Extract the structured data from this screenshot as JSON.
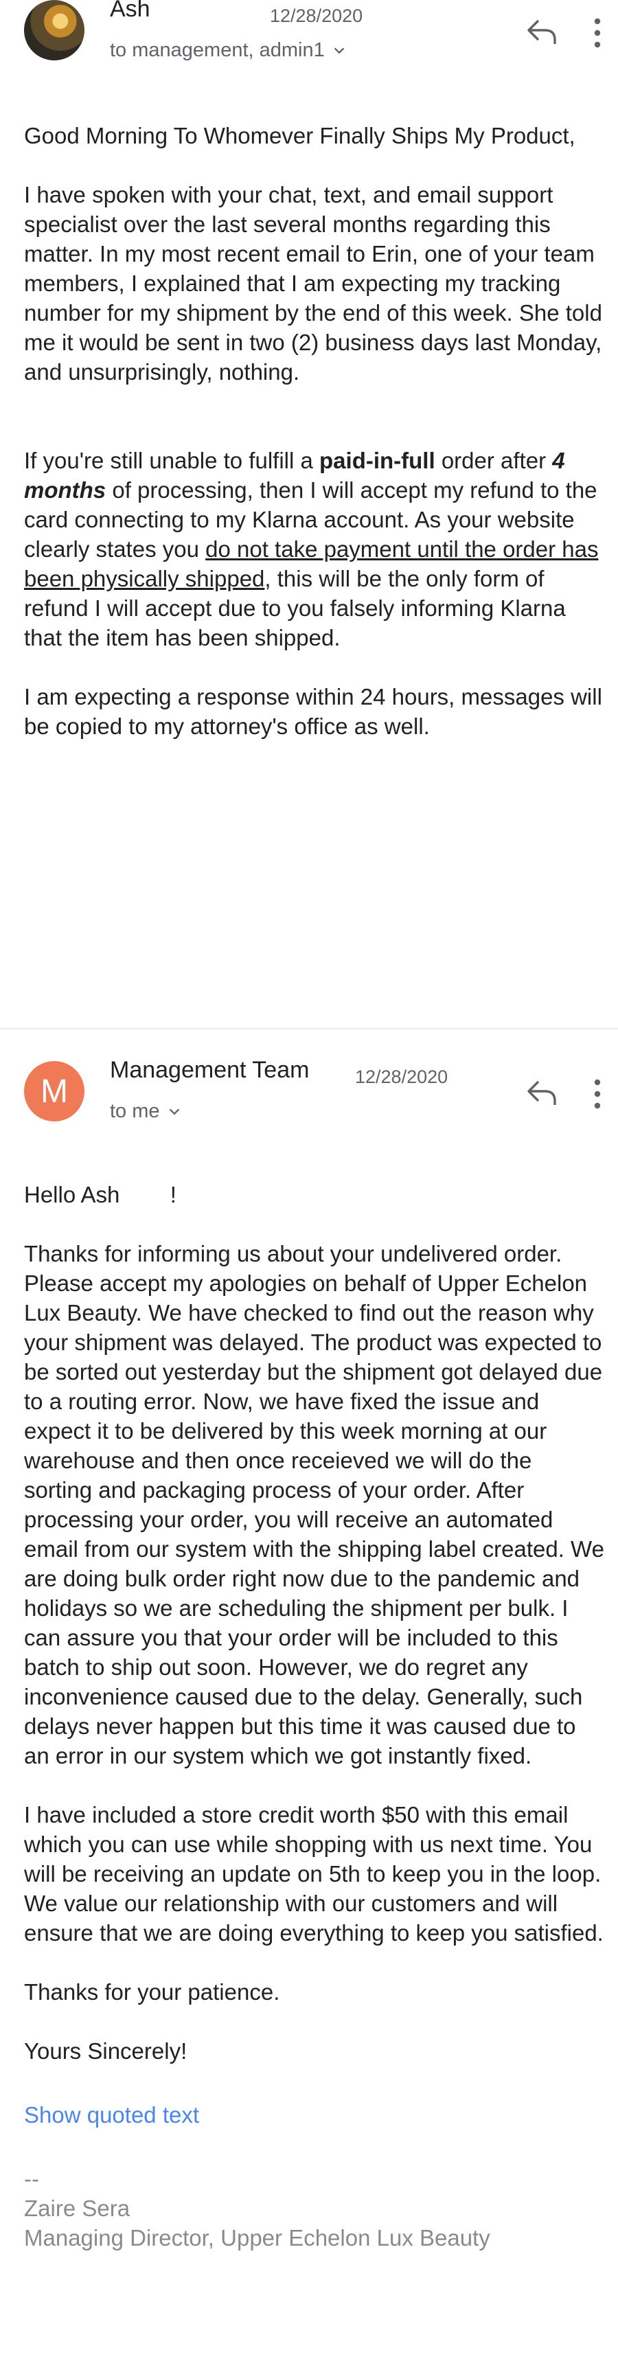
{
  "message1": {
    "sender": "Ash",
    "date": "12/28/2020",
    "recipients": "to management, admin1",
    "greeting": "Good Morning To Whomever Finally Ships My Product,",
    "para1": "I have spoken with your chat, text, and email support specialist over the last several months regarding this matter. In my most recent email to Erin, one of your team members, I explained that I am expecting my tracking number for my shipment by the end of this week. She told me it would be sent in two (2) business days last Monday, and unsurprisingly, nothing.",
    "para2": {
      "t1": "If you're still unable to fulfill a ",
      "b1": "paid-in-full",
      "t2": " order after ",
      "bi1": "4 months",
      "t3": " of processing, then I will accept my refund to the card connecting to my Klarna account. As your website clearly states you ",
      "u1": "do not take payment until the order has been physically shipped",
      "t4": ", this will be the only form of refund I will accept due to you falsely informing Klarna that the item has been shipped."
    },
    "para3": "I am expecting a response within 24 hours, messages will be copied to my attorney's office as well."
  },
  "message2": {
    "avatar_letter": "M",
    "sender": "Management Team",
    "date": "12/28/2020",
    "recipients": "to me",
    "greeting": "Hello Ash        !",
    "para1": "Thanks for informing us about your undelivered order. Please accept my apologies on behalf of Upper Echelon Lux Beauty. We have checked to find out the reason why your shipment was delayed. The product was expected to be sorted out yesterday but the shipment got delayed due to a routing error. Now, we have fixed the issue and expect it to be delivered by this week morning at our warehouse and then once receieved we will do the sorting and packaging process of your order. After processing your order, you will receive an automated email from our system with the shipping label created. We are doing bulk order right now due to the pandemic and holidays so we are scheduling the shipment per bulk. I can assure you that your order will be included to this batch to ship out soon. However, we do regret any inconvenience caused due to the delay. Generally, such delays never happen but this time it was caused due to an error in our system which we got instantly fixed.",
    "para2": "I have included a store credit worth $50 with this email which you can use while shopping with us next time. You will be receiving an update on 5th to keep you in the loop. We value our relationship with our customers and will ensure that we are doing everything to keep you satisfied.",
    "para3": "Thanks for your patience.",
    "closing": "Yours Sincerely!",
    "show_quoted": "Show quoted text",
    "sig_dash": "--",
    "sig_name": "Zaire Sera",
    "sig_title": "Managing Director, Upper Echelon Lux Beauty"
  },
  "colors": {
    "accent_link": "#4a86e8",
    "avatar_m": "#f07a55",
    "muted": "#5f6368"
  }
}
